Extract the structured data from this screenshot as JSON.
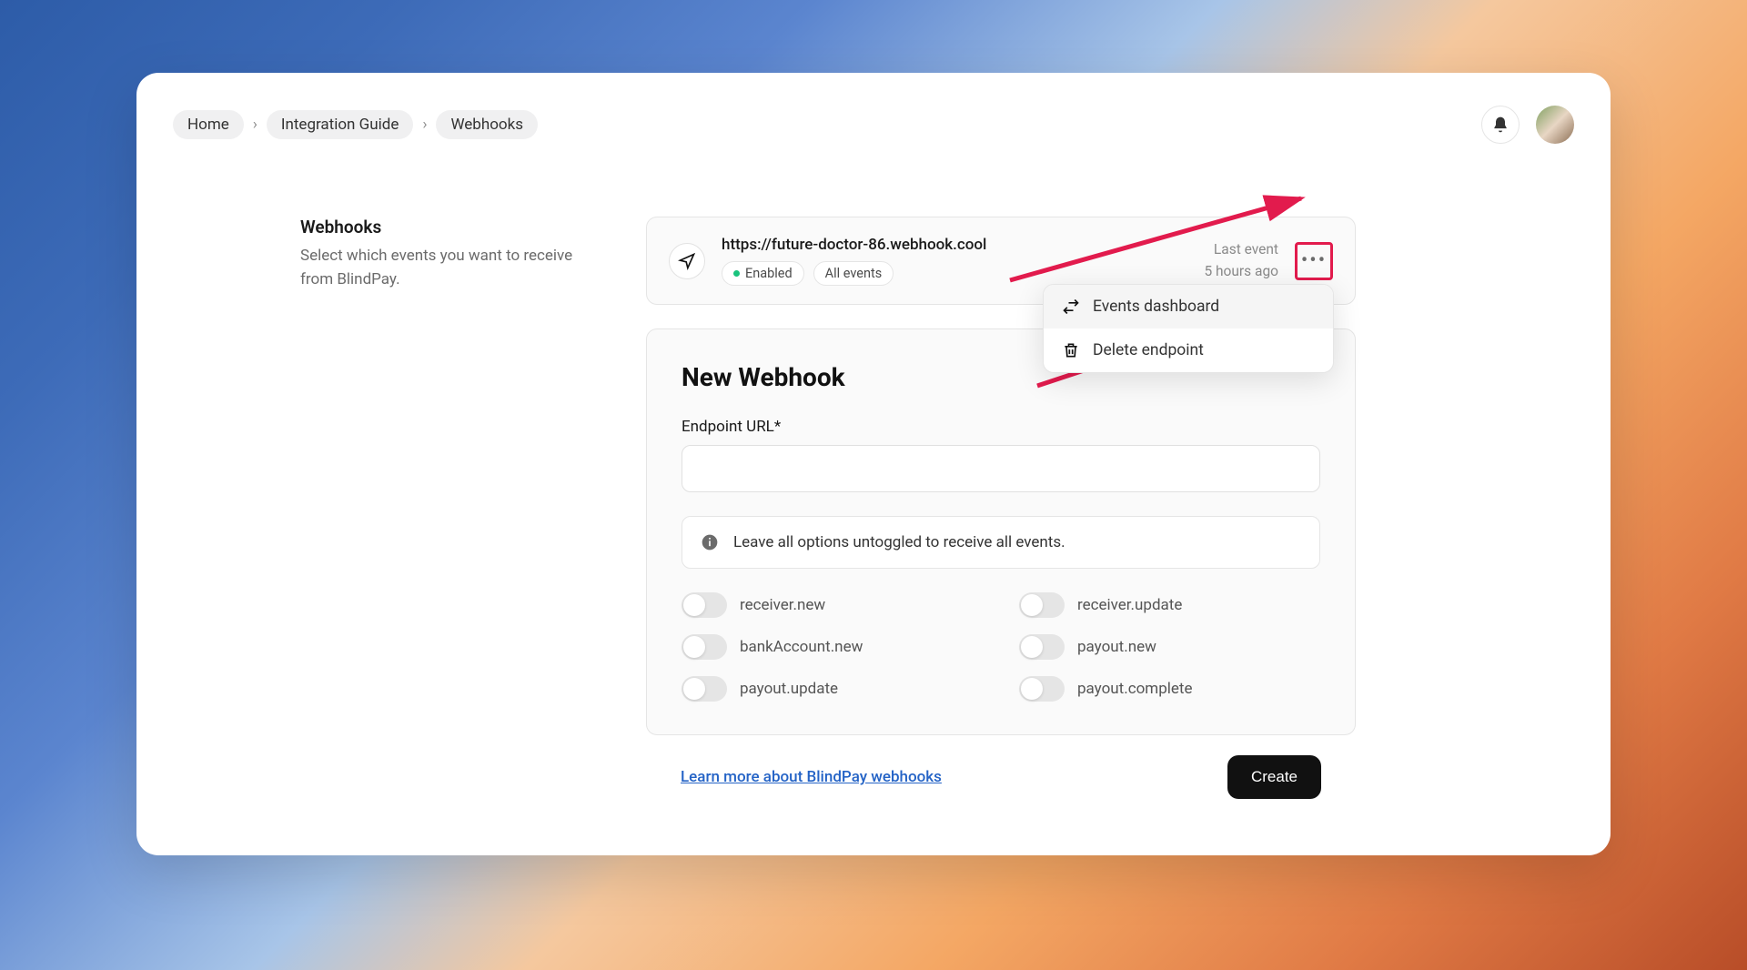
{
  "breadcrumb": {
    "items": [
      "Home",
      "Integration Guide",
      "Webhooks"
    ]
  },
  "left": {
    "title": "Webhooks",
    "subtitle": "Select which events you want to receive from BlindPay."
  },
  "webhook": {
    "url": "https://future-doctor-86.webhook.cool",
    "status": "Enabled",
    "scope": "All events",
    "last_event_label": "Last event",
    "last_event_time": "5 hours ago"
  },
  "dropdown": {
    "item1": "Events dashboard",
    "item2": "Delete endpoint"
  },
  "form": {
    "heading": "New Webhook",
    "endpoint_label": "Endpoint URL*",
    "endpoint_value": "",
    "info": "Leave all options untoggled to receive all events.",
    "events": [
      "receiver.new",
      "receiver.update",
      "bankAccount.new",
      "payout.new",
      "payout.update",
      "payout.complete"
    ],
    "learn_link": "Learn more about BlindPay webhooks",
    "create": "Create"
  }
}
